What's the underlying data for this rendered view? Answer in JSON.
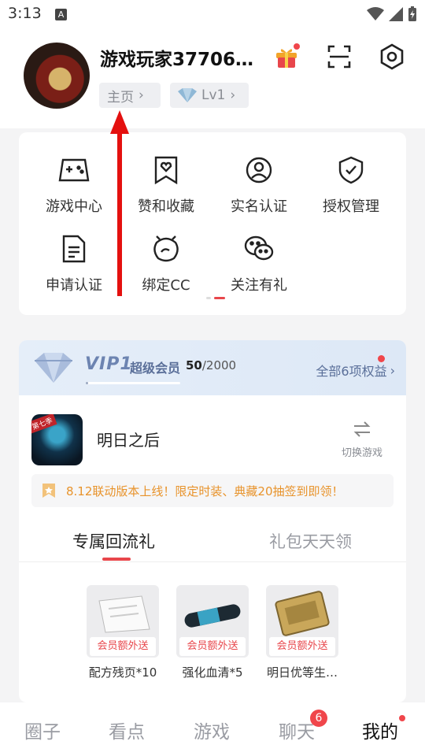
{
  "status_bar": {
    "time": "3:13",
    "notification_icon": "A"
  },
  "profile": {
    "username": "游戏玩家377069…",
    "home_chip": "主页",
    "level_chip": "Lv1"
  },
  "grid": [
    {
      "label": "游戏中心",
      "icon": "gamepad-icon"
    },
    {
      "label": "赞和收藏",
      "icon": "bookmark-heart-icon"
    },
    {
      "label": "实名认证",
      "icon": "user-circle-icon"
    },
    {
      "label": "授权管理",
      "icon": "shield-check-icon"
    },
    {
      "label": "申请认证",
      "icon": "document-icon"
    },
    {
      "label": "绑定CC",
      "icon": "cc-bind-icon"
    },
    {
      "label": "关注有礼",
      "icon": "wechat-icon"
    }
  ],
  "vip": {
    "brand": "VIP1",
    "tier": "超级会员",
    "points_current": "50",
    "points_total": "/2000",
    "progress_fraction": 0.025,
    "benefits_text": "全部6项权益"
  },
  "game": {
    "name": "明日之后",
    "icon_tag": "第七季",
    "switch_label": "切换游戏"
  },
  "notice": "8.12联动版本上线！限定时装、典藏20抽签到即领！",
  "tabs": {
    "active": "专属回流礼",
    "inactive": "礼包天天领"
  },
  "gifts": [
    {
      "badge": "会员额外送",
      "name": "配方残页*10"
    },
    {
      "badge": "会员额外送",
      "name": "强化血清*5"
    },
    {
      "badge": "会员额外送",
      "name": "明日优等生…"
    }
  ],
  "bottom_nav": [
    {
      "label": "圈子"
    },
    {
      "label": "看点"
    },
    {
      "label": "游戏"
    },
    {
      "label": "聊天",
      "badge": "6"
    },
    {
      "label": "我的"
    }
  ],
  "colors": {
    "accent_red": "#e8464b",
    "vip_blue": "#5a6f99",
    "notice_orange": "#e8932b"
  }
}
